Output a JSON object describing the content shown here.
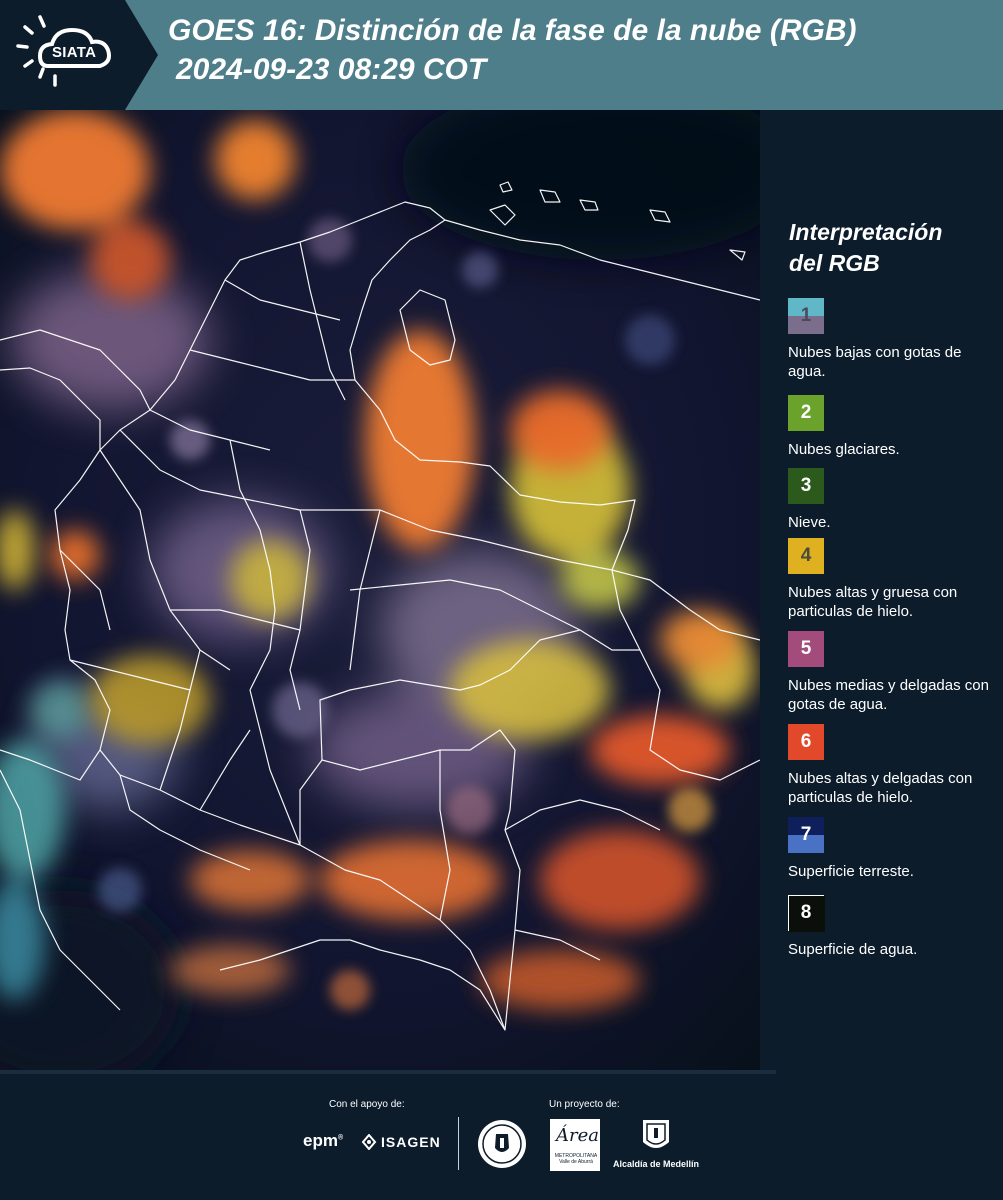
{
  "header": {
    "brand": "SIATA",
    "title": "GOES 16: Distinción de la fase de la nube (RGB)",
    "subtitle": "2024-09-23 08:29 COT"
  },
  "legend": {
    "title_line1": "Interpretación",
    "title_line2": "del RGB",
    "items": [
      {
        "number": "1",
        "label": "Nubes bajas con gotas de agua.",
        "color_top": "#5fb7c7",
        "color_bottom": "#7a6e8c",
        "number_color": "#4a4a5a"
      },
      {
        "number": "2",
        "label": "Nubes glaciares.",
        "color_top": "#6aa22c",
        "color_bottom": "#6aa22c",
        "number_color": "#ffffff"
      },
      {
        "number": "3",
        "label": "Nieve.",
        "color_top": "#2c5a1c",
        "color_bottom": "#2c5a1c",
        "number_color": "#ffffff"
      },
      {
        "number": "4",
        "label": "Nubes altas y gruesa con particulas de hielo.",
        "color_top": "#dfb020",
        "color_bottom": "#dfb020",
        "number_color": "#4a4a3a"
      },
      {
        "number": "5",
        "label": "Nubes medias y delgadas con gotas de agua.",
        "color_top": "#a34b7b",
        "color_bottom": "#a34b7b",
        "number_color": "#ffffff"
      },
      {
        "number": "6",
        "label": "Nubes altas y delgadas con particulas de hielo.",
        "color_top": "#e2482a",
        "color_bottom": "#e2482a",
        "number_color": "#ffffff"
      },
      {
        "number": "7",
        "label": "Superficie terreste.",
        "color_top": "#0e1f5c",
        "color_bottom": "#4a72c4",
        "number_color": "#ffffff"
      },
      {
        "number": "8",
        "label": "Superficie de agua.",
        "color_top": "#0a0f0a",
        "color_bottom": "#0a0f0a",
        "number_color": "#ffffff"
      }
    ]
  },
  "footer": {
    "support_caption": "Con el apoyo de:",
    "project_caption": "Un proyecto de:",
    "epm": "epm",
    "isagen": "ISAGEN",
    "area_script": "Área",
    "area_sub": "METROPOLITANA Valle de Aburrá",
    "alcaldia": "Alcaldía de Medellín"
  },
  "colors": {
    "header_bg": "#4f7e8b",
    "panel_bg": "#0c1c2b",
    "cloud_orange": "#f07a30",
    "cloud_yellow": "#e2c23a",
    "cloud_pink": "#a07a9a",
    "cloud_cyan": "#5fb7b7"
  }
}
